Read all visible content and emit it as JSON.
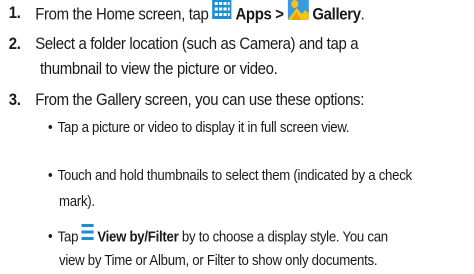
{
  "steps": [
    {
      "number": "1.",
      "prefix": "From the Home screen, tap",
      "apps_label": "Apps >",
      "gallery_label": "Gallery",
      "suffix": "."
    },
    {
      "number": "2.",
      "line1": "Select a folder location (such as Camera) and tap a",
      "line2": "thumbnail to view the picture or video."
    },
    {
      "number": "3.",
      "line1": "From the Gallery screen, you can use these options:"
    }
  ],
  "bullets": [
    {
      "bullet": "•",
      "text": "Tap a picture or video to display it in full screen view."
    },
    {
      "bullet": "•",
      "line1": "Touch and hold thumbnails to select them (indicated by a check",
      "line2": "mark)."
    },
    {
      "bullet": "•",
      "tap": "Tap",
      "label": "View by/Filter",
      "line1_rest": "by to choose a display style. You can",
      "line2": "view by Time or Album, or Filter to show only documents."
    }
  ],
  "colors": {
    "apps_icon": "#1a8fd6",
    "gallery_yellow": "#f4c21a",
    "gallery_blue": "#3a9ae0",
    "menu_icon": "#1a8fd6",
    "text": "#1a1a1a"
  },
  "icons": [
    "apps-grid-icon",
    "gallery-icon",
    "view-menu-icon"
  ]
}
